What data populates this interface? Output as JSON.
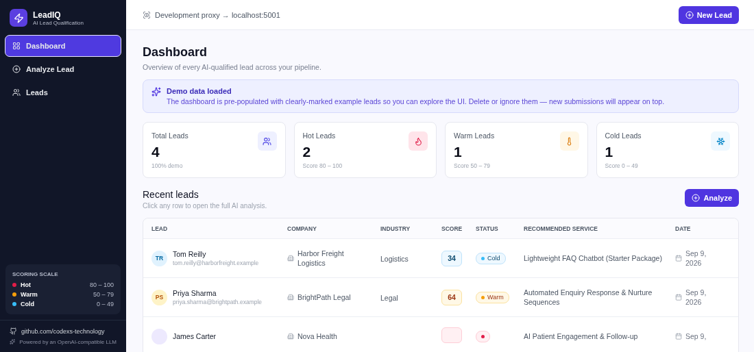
{
  "brand": {
    "name": "LeadIQ",
    "tagline": "AI Lead Qualification"
  },
  "nav": [
    {
      "label": "Dashboard",
      "selected": true
    },
    {
      "label": "Analyze Lead",
      "selected": false
    },
    {
      "label": "Leads",
      "selected": false
    }
  ],
  "scoring_scale": {
    "title": "SCORING SCALE",
    "items": [
      {
        "label": "Hot",
        "range": "80 – 100",
        "color": "#e11d48"
      },
      {
        "label": "Warm",
        "range": "50 – 79",
        "color": "#f59e0b"
      },
      {
        "label": "Cold",
        "range": "0 – 49",
        "color": "#38bdf8"
      }
    ]
  },
  "footer": {
    "link": "github.com/codexs-technology",
    "note": "Powered by an OpenAI-compatible LLM"
  },
  "topbar": {
    "proxy": "Development proxy → localhost:5001",
    "button": "New Lead"
  },
  "page": {
    "title": "Dashboard",
    "subtitle": "Overview of every AI-qualified lead across your pipeline."
  },
  "notice": {
    "title": "Demo data loaded",
    "text": "The dashboard is pre-populated with clearly-marked example leads so you can explore the UI. Delete or ignore them — new submissions will appear on top."
  },
  "stats": [
    {
      "label": "Total Leads",
      "value": "4",
      "note": "100% demo",
      "kind": "total"
    },
    {
      "label": "Hot Leads",
      "value": "2",
      "note": "Score 80 – 100",
      "kind": "hot"
    },
    {
      "label": "Warm Leads",
      "value": "1",
      "note": "Score 50 – 79",
      "kind": "warm"
    },
    {
      "label": "Cold Leads",
      "value": "1",
      "note": "Score 0 – 49",
      "kind": "cold"
    }
  ],
  "recent": {
    "title": "Recent leads",
    "subtitle": "Click any row to open the full AI analysis.",
    "button": "Analyze"
  },
  "table": {
    "columns": [
      "LEAD",
      "COMPANY",
      "INDUSTRY",
      "SCORE",
      "STATUS",
      "RECOMMENDED SERVICE",
      "DATE"
    ],
    "rows": [
      {
        "initials": "TR",
        "name": "Tom Reilly",
        "email": "tom.reilly@harborfreight.example",
        "company": "Harbor Freight Logistics",
        "industry": "Logistics",
        "score": "34",
        "status": "Cold",
        "kind": "cold",
        "service": "Lightweight FAQ Chatbot (Starter Package)",
        "date": "Sep 9, 2026"
      },
      {
        "initials": "PS",
        "name": "Priya Sharma",
        "email": "priya.sharma@brightpath.example",
        "company": "BrightPath Legal",
        "industry": "Legal",
        "score": "64",
        "status": "Warm",
        "kind": "warm",
        "service": "Automated Enquiry Response & Nurture Sequences",
        "date": "Sep 9, 2026"
      },
      {
        "name": "James Carter",
        "company": "Nova Health",
        "kind": "hot",
        "service": "AI Patient Engagement & Follow-up",
        "date": "Sep 9,"
      }
    ]
  }
}
